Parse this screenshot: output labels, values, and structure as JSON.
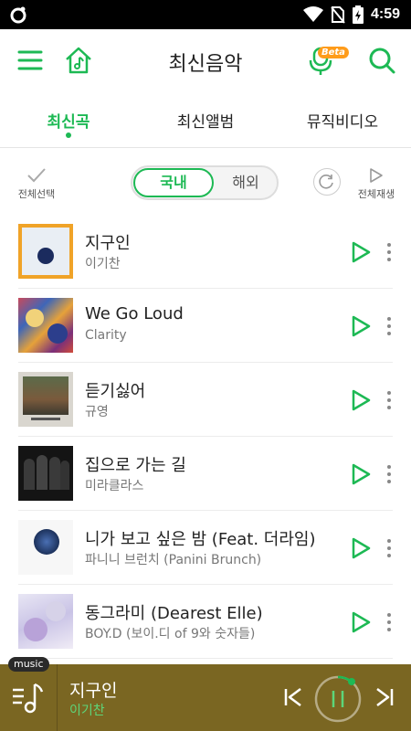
{
  "status_bar": {
    "time": "4:59"
  },
  "header": {
    "title": "최신음악",
    "beta_badge": "Beta"
  },
  "tabs": [
    {
      "label": "최신곡",
      "active": true
    },
    {
      "label": "최신앨범",
      "active": false
    },
    {
      "label": "뮤직비디오",
      "active": false
    }
  ],
  "controls": {
    "select_all": "전체선택",
    "domestic": "국내",
    "overseas": "해외",
    "play_all": "전체재생"
  },
  "songs": [
    {
      "title": "지구인",
      "artist": "이기찬"
    },
    {
      "title": "We Go Loud",
      "artist": "Clarity"
    },
    {
      "title": "듣기싫어",
      "artist": "규영"
    },
    {
      "title": "집으로 가는 길",
      "artist": "미라클라스"
    },
    {
      "title": "니가 보고 싶은 밤 (Feat. 더라임)",
      "artist": "파니니 브런치 (Panini Brunch)"
    },
    {
      "title": "동그라미 (Dearest Elle)",
      "artist": "BOY.D (보이.디 of 9와 숫자들)"
    }
  ],
  "player": {
    "badge": "music",
    "title": "지구인",
    "artist": "이기찬"
  },
  "colors": {
    "accent": "#1db954",
    "player_bg": "#7a6622"
  }
}
